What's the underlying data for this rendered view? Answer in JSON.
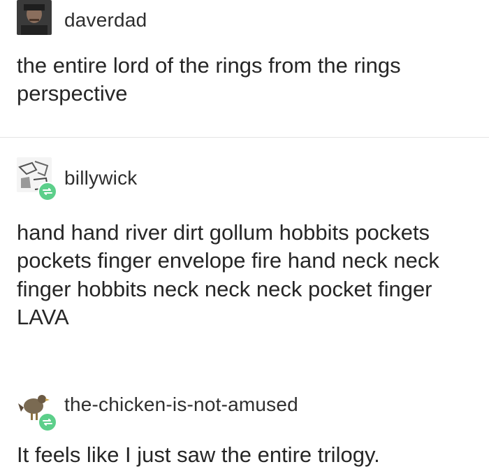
{
  "posts": [
    {
      "username": "daverdad",
      "text": "the entire lord of the rings from the rings perspective",
      "avatar_icon": "portrait-avatar-icon",
      "reblogged": false
    },
    {
      "username": "billywick",
      "text": "hand hand river dirt gollum hobbits pockets pockets finger envelope fire hand neck neck finger hobbits neck neck neck pocket finger LAVA",
      "avatar_icon": "sketch-avatar-icon",
      "reblogged": true
    },
    {
      "username": "the-chicken-is-not-amused",
      "text": "It feels like I just saw the entire trilogy.",
      "avatar_icon": "chicken-avatar-icon",
      "reblogged": true
    }
  ],
  "colors": {
    "reblog_badge": "#5ccf8a",
    "text": "#262626",
    "divider": "#e4e4e4"
  }
}
